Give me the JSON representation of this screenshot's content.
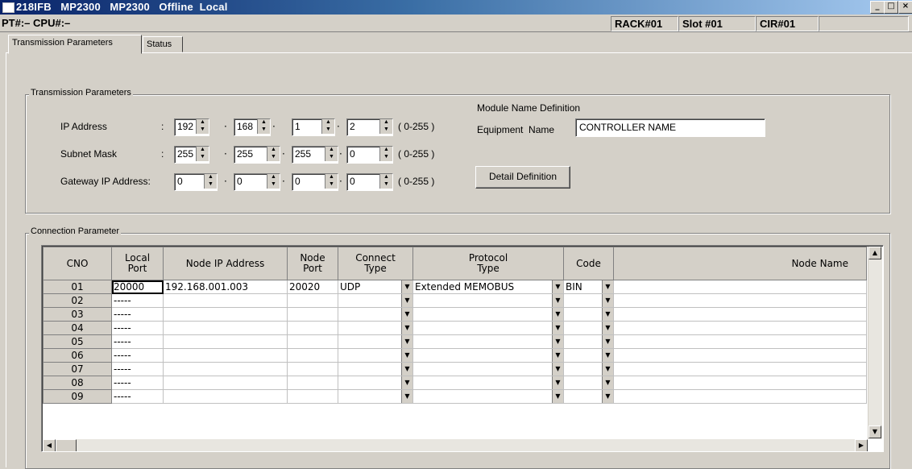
{
  "window": {
    "title": "218IFB   MP2300   MP2300   Offline  Local",
    "controls": [
      "_",
      "□",
      "×"
    ]
  },
  "status": {
    "pt_cpu": "PT#:– CPU#:–",
    "rack": "RACK#01",
    "slot": "Slot #01",
    "cir": "CIR#01"
  },
  "tabs": [
    {
      "label": "Transmission Parameters",
      "active": true
    },
    {
      "label": "Status",
      "active": false
    }
  ],
  "transmission": {
    "group_label": "Transmission Parameters",
    "ip_label": "IP Address",
    "subnet_label": "Subnet Mask",
    "gateway_label": "Gateway IP Address:",
    "ip": [
      "192",
      "168",
      "1",
      "2"
    ],
    "subnet": [
      "255",
      "255",
      "255",
      "0"
    ],
    "gateway": [
      "0",
      "0",
      "0",
      "0"
    ],
    "range": "( 0-255 )",
    "module_name_label": "Module Name Definition",
    "equipment_name_label": "Equipment  Name",
    "equipment_name_value": "CONTROLLER NAME",
    "detail_button": "Detail Definition"
  },
  "connection": {
    "group_label": "Connection Parameter",
    "headers": [
      "CNO",
      "Local\nPort",
      "Node IP Address",
      "Node\nPort",
      "Connect\nType",
      "Protocol\nType",
      "Code",
      "Node Name"
    ],
    "rows": [
      {
        "cno": "01",
        "local_port": "20000",
        "node_ip": "192.168.001.003",
        "node_port": "20020",
        "connect_type": "UDP",
        "protocol": "Extended MEMOBUS",
        "code": "BIN",
        "node_name": ""
      },
      {
        "cno": "02",
        "local_port": "-----",
        "node_ip": "",
        "node_port": "",
        "connect_type": "",
        "protocol": "",
        "code": "",
        "node_name": ""
      },
      {
        "cno": "03",
        "local_port": "-----",
        "node_ip": "",
        "node_port": "",
        "connect_type": "",
        "protocol": "",
        "code": "",
        "node_name": ""
      },
      {
        "cno": "04",
        "local_port": "-----",
        "node_ip": "",
        "node_port": "",
        "connect_type": "",
        "protocol": "",
        "code": "",
        "node_name": ""
      },
      {
        "cno": "05",
        "local_port": "-----",
        "node_ip": "",
        "node_port": "",
        "connect_type": "",
        "protocol": "",
        "code": "",
        "node_name": ""
      },
      {
        "cno": "06",
        "local_port": "-----",
        "node_ip": "",
        "node_port": "",
        "connect_type": "",
        "protocol": "",
        "code": "",
        "node_name": ""
      },
      {
        "cno": "07",
        "local_port": "-----",
        "node_ip": "",
        "node_port": "",
        "connect_type": "",
        "protocol": "",
        "code": "",
        "node_name": ""
      },
      {
        "cno": "08",
        "local_port": "-----",
        "node_ip": "",
        "node_port": "",
        "connect_type": "",
        "protocol": "",
        "code": "",
        "node_name": ""
      },
      {
        "cno": "09",
        "local_port": "-----",
        "node_ip": "",
        "node_port": "",
        "connect_type": "",
        "protocol": "",
        "code": "",
        "node_name": ""
      }
    ]
  },
  "colors": {
    "titlebar_start": "#0a246a",
    "titlebar_end": "#a6caf0",
    "face": "#d4d0c8"
  }
}
